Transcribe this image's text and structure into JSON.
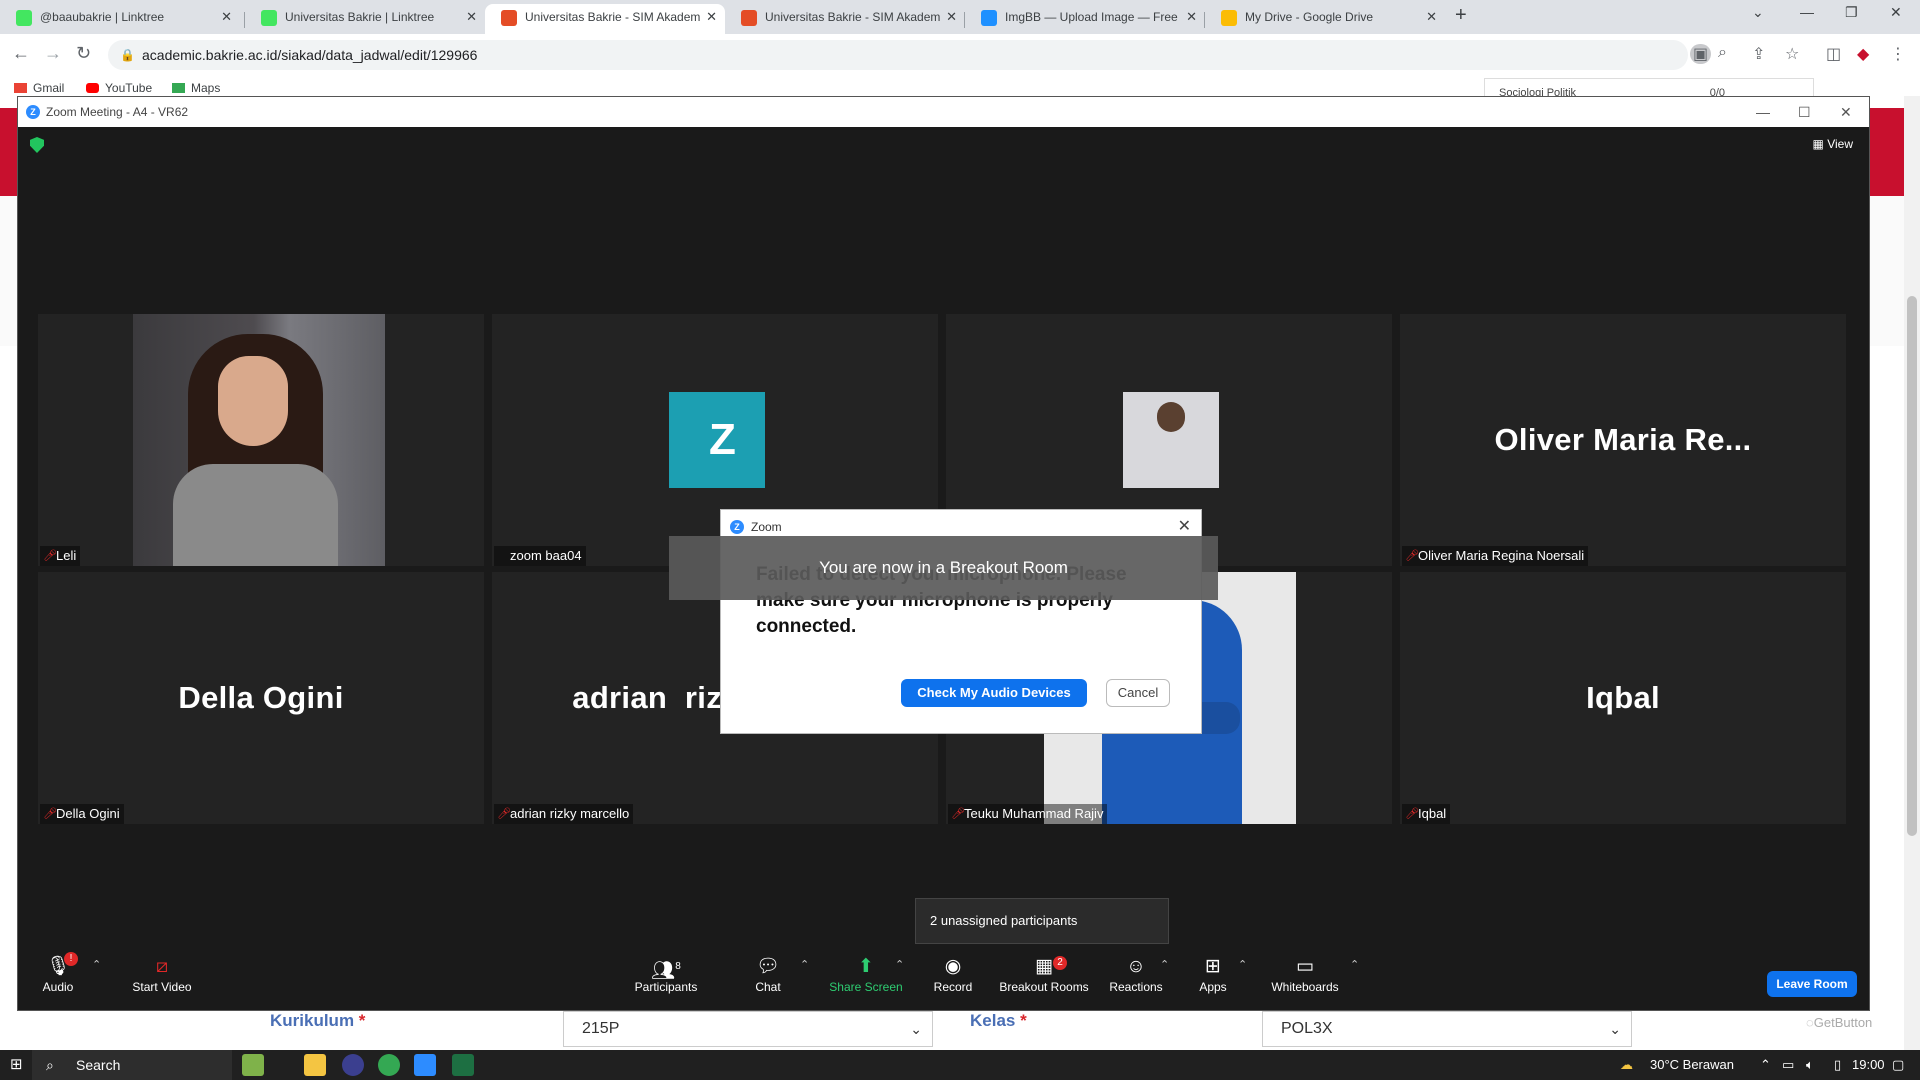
{
  "browser": {
    "tabs": [
      {
        "label": "@baaubakrie | Linktree",
        "active": false,
        "favicon_color": "#43e660"
      },
      {
        "label": "Universitas Bakrie | Linktree",
        "active": false,
        "favicon_color": "#43e660"
      },
      {
        "label": "Universitas Bakrie - SIM Akadem",
        "active": true,
        "favicon_color": "#e44d26"
      },
      {
        "label": "Universitas Bakrie - SIM Akadem",
        "active": false,
        "favicon_color": "#e44d26"
      },
      {
        "label": "ImgBB — Upload Image — Free",
        "active": false,
        "favicon_color": "#1e90ff"
      },
      {
        "label": "My Drive - Google Drive",
        "active": false,
        "favicon_color": "#fbbc04"
      }
    ],
    "url": "academic.bakrie.ac.id/siakad/data_jadwal/edit/129966",
    "bookmarks": [
      {
        "label": "Gmail",
        "color": "#ea4335"
      },
      {
        "label": "YouTube",
        "color": "#ff0000"
      },
      {
        "label": "Maps",
        "color": "#34a853"
      }
    ]
  },
  "page": {
    "floating_text": "Sociologi Politik",
    "floating_count": "0/0",
    "form": {
      "kurikulum_label": "Kurikulum",
      "kurikulum_value": "215P",
      "kelas_label": "Kelas",
      "kelas_value": "POL3X",
      "required_mark": "*"
    },
    "getbutton": "GetButton"
  },
  "zoom": {
    "window_title": "Zoom Meeting - A4 - VR62",
    "view_label": "View",
    "tiles": [
      {
        "name": "Leli",
        "kind": "photo-leli"
      },
      {
        "name": "zoom baa04",
        "kind": "z-avatar"
      },
      {
        "name": "",
        "kind": "thumb"
      },
      {
        "name": "Oliver Maria Regina Noersali",
        "big": "Oliver Maria Re...",
        "kind": "name"
      },
      {
        "name": "Della Ogini",
        "big": "Della Ogini",
        "kind": "name"
      },
      {
        "name": "adrian rizky marcello",
        "big": "adrian  rizky  mar...",
        "kind": "name"
      },
      {
        "name": "Teuku Muhammad Rajiv",
        "kind": "photo-rajiv"
      },
      {
        "name": "Iqbal",
        "big": "Iqbal",
        "kind": "name"
      }
    ],
    "z_avatar_letter": "Z",
    "breakout_banner": "You are now in a Breakout Room",
    "dialog": {
      "title": "Zoom",
      "message": "Failed to detect your microphone. Please make sure your microphone is properly connected.",
      "primary_button": "Check My Audio Devices",
      "secondary_button": "Cancel"
    },
    "unassigned_popup": "2 unassigned participants",
    "toolbar": {
      "audio": "Audio",
      "start_video": "Start Video",
      "participants": "Participants",
      "participants_count": "8",
      "chat": "Chat",
      "share_screen": "Share Screen",
      "record": "Record",
      "breakout_rooms": "Breakout Rooms",
      "breakout_badge": "2",
      "reactions": "Reactions",
      "apps": "Apps",
      "whiteboards": "Whiteboards",
      "leave_room": "Leave Room",
      "audio_badge": "!"
    }
  },
  "taskbar": {
    "search": "Search",
    "weather": "30°C  Berawan",
    "time": "19:00"
  }
}
